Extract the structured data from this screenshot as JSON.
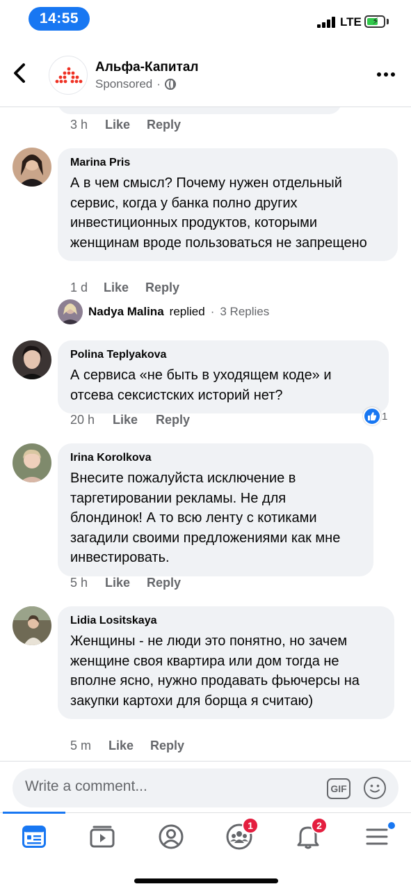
{
  "status_bar": {
    "time": "14:55",
    "network": "LTE"
  },
  "header": {
    "page_name": "Альфа-Капитал",
    "sponsored_label": "Sponsored",
    "separator": "·"
  },
  "previous_comment": {
    "time": "3 h",
    "like": "Like",
    "reply": "Reply"
  },
  "comments": [
    {
      "author": "Marina  Pris",
      "text": "А в чем смысл? Почему нужен отдельный сервис, когда у банка полно других инвестиционных продуктов, которыми женщинам вроде пользоваться не запрещено",
      "time": "1 d",
      "like": "Like",
      "reply": "Reply"
    },
    {
      "author": "Polina Teplyakova",
      "text": "А сервиса «не быть в уходящем коде» и отсева сексистских историй нет?",
      "time": "20 h",
      "like": "Like",
      "reply": "Reply",
      "reaction_count": "1"
    },
    {
      "author": "Irina Korolkova",
      "text": "Внесите пожалуйста исключение в таргетировании рекламы. Не для блондинок! А то всю ленту с котиками загадили своими предложениями как мне инвестировать.",
      "time": "5 h",
      "like": "Like",
      "reply": "Reply"
    },
    {
      "author": "Lidia Lositskaya",
      "text": "Женщины - не люди это понятно, но зачем женщине своя квартира или дом тогда не вполне ясно, нужно продавать фьючерсы на закупки картохи для борща я считаю)",
      "time": "5 m",
      "like": "Like",
      "reply": "Reply"
    }
  ],
  "reply_thread": {
    "name": "Nadya Malina",
    "action": "replied",
    "separator": "·",
    "count": "3 Replies"
  },
  "composer": {
    "placeholder": "Write a comment...",
    "gif_label": "GIF"
  },
  "tab_bar": {
    "tabs": [
      {
        "name": "news-feed",
        "active": true
      },
      {
        "name": "watch",
        "active": false
      },
      {
        "name": "profile",
        "active": false
      },
      {
        "name": "groups",
        "active": false,
        "badge": "1"
      },
      {
        "name": "notifications",
        "active": false,
        "badge": "2"
      },
      {
        "name": "menu",
        "active": false
      }
    ]
  },
  "colors": {
    "accent": "#1877f2",
    "bubble": "#f0f2f5",
    "secondary_text": "#65676b",
    "badge": "#e41e3f",
    "brand_red": "#ef3124"
  }
}
